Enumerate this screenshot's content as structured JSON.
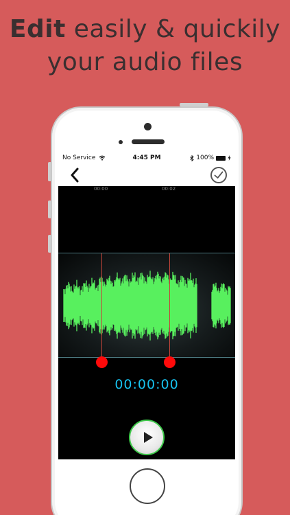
{
  "headline": {
    "bold": "Edit",
    "rest": "easily & quickily",
    "line2": "your audio files"
  },
  "status_bar": {
    "carrier": "No Service",
    "time": "4:45 PM",
    "battery_percent": "100%"
  },
  "nav": {
    "back_icon": "chevron-left-icon",
    "done_icon": "checkmark-circle-icon"
  },
  "timeline": {
    "labels": [
      "00:00",
      "00:02"
    ]
  },
  "player": {
    "timecode": "00:00:00",
    "play_icon": "play-icon"
  },
  "colors": {
    "background": "#d65b5b",
    "waveform": "#58f05e",
    "timecode": "#17c2ef",
    "marker": "#ff0a0a"
  }
}
